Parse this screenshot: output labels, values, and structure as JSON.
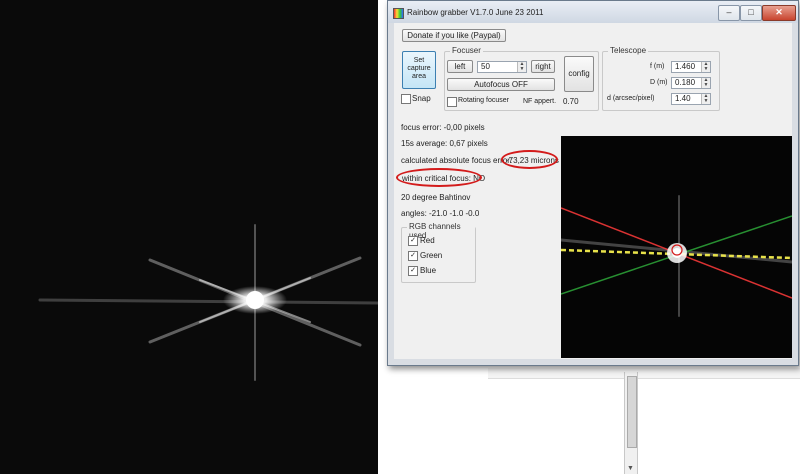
{
  "window": {
    "title": "Rainbow grabber  V1.7.0 June 23 2011",
    "buttons": {
      "minimize": "–",
      "maximize": "□",
      "close": "✕"
    }
  },
  "donate_label": "Donate if you like (Paypal)",
  "capture": {
    "set_capture_area": "Set capture area",
    "snap_label": "Snap",
    "snap_checked": false
  },
  "focuser": {
    "title": "Focuser",
    "left_label": "left",
    "step_value": "50",
    "right_label": "right",
    "config_label": "config",
    "autofocus_label": "Autofocus OFF",
    "rotating_focuser_label": "Rotating focuser",
    "rotating_focuser_checked": false,
    "nf_appert_label": "NF appert.",
    "nf_appert_value": "0.70"
  },
  "telescope": {
    "title": "Telescope",
    "fields": [
      {
        "label": "f (m)",
        "value": "1.460"
      },
      {
        "label": "D (m)",
        "value": "0.180"
      },
      {
        "label": "d (arcsec/pixel)",
        "value": "1.40"
      }
    ]
  },
  "stats": {
    "focus_error": "focus error: -0,00 pixels",
    "average": "15s average: 0,67 pixels",
    "absolute_focus_error_label": "calculated absolute focus error:",
    "absolute_focus_error_value": "-73,23 microns",
    "within_critical_focus": "within critical focus: NO",
    "bahtinov": "20 degree Bahtinov",
    "angles": "angles: -21.0  -1.0  -0.0"
  },
  "rgb": {
    "title": "RGB channels used",
    "channels": [
      {
        "label": "Red",
        "checked": true
      },
      {
        "label": "Green",
        "checked": true
      },
      {
        "label": "Blue",
        "checked": true
      }
    ]
  },
  "colors": {
    "highlight_oval": "#d31b1b",
    "red_line": "#ff3b3b",
    "green_line": "#2ea83a",
    "yellow_line": "#e8e24a",
    "window_frame": "#d9dde3",
    "client_bg": "#f0f0f0",
    "starfield_bg": "#0a0a0a"
  },
  "icons": {
    "app_icon": "rainbow-app-icon",
    "checkbox_check": "✓",
    "spin_up": "▲",
    "spin_down": "▼",
    "scroll_down_arrow": "▼"
  }
}
